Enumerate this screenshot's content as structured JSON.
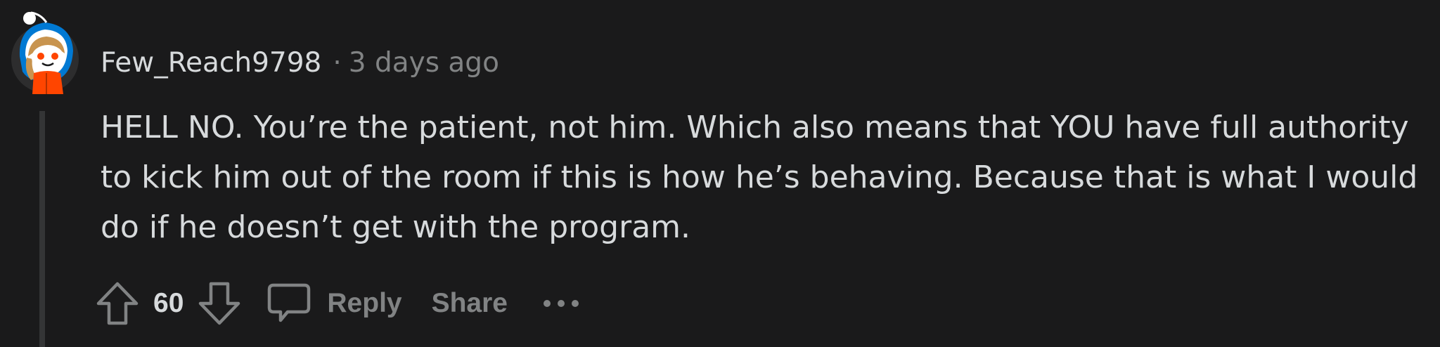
{
  "comment": {
    "author": "Few_Reach9798",
    "separator": "·",
    "timestamp": "3 days ago",
    "body": "HELL NO. You’re the patient, not him. Which also means that YOU have full authority to kick him out of the room if this is how he’s behaving. Because that is what I would do if he doesn’t get with the program.",
    "score": "60"
  },
  "actions": {
    "reply_label": "Reply",
    "share_label": "Share"
  },
  "icons": {
    "upvote": "arrow-up-outline-icon",
    "downvote": "arrow-down-outline-icon",
    "comment": "speech-bubble-icon",
    "more": "ellipsis-icon",
    "avatar": "snoo-avatar"
  },
  "colors": {
    "background": "#1a1a1b",
    "text_primary": "#d7dadc",
    "text_secondary": "#818384",
    "thread_line": "#343536",
    "avatar_orange": "#ff4500",
    "avatar_blue": "#0079d3"
  }
}
